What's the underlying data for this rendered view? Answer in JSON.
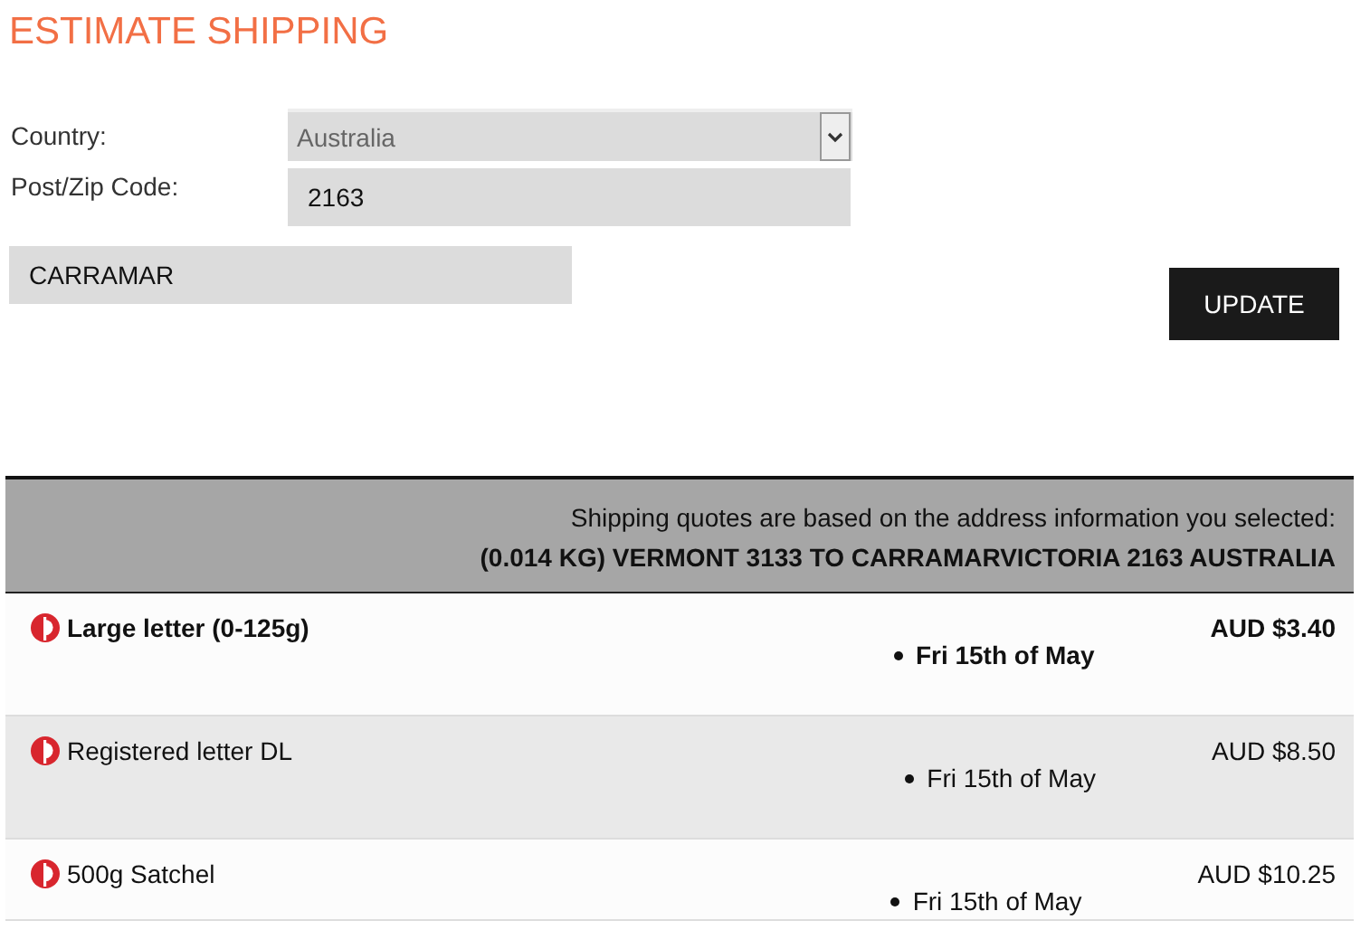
{
  "title": "ESTIMATE SHIPPING",
  "form": {
    "country_label": "Country:",
    "country_value": "Australia",
    "postcode_label": "Post/Zip Code:",
    "postcode_value": "2163",
    "suburb_value": "CARRAMAR",
    "update_button": "UPDATE"
  },
  "quotes_header": {
    "note": "Shipping quotes are based on the address information you selected:",
    "route": "(0.014 KG) VERMONT 3133 TO CARRAMARVICTORIA 2163 AUSTRALIA"
  },
  "quotes": [
    {
      "name": "Large letter (0-125g)",
      "date": "Fri 15th of May",
      "price": "AUD $3.40",
      "selected": true
    },
    {
      "name": "Registered letter DL",
      "date": "Fri 15th of May",
      "price": "AUD $8.50",
      "selected": false
    },
    {
      "name": "500g Satchel",
      "date": "Fri 15th of May",
      "price": "AUD $10.25",
      "selected": false
    }
  ]
}
